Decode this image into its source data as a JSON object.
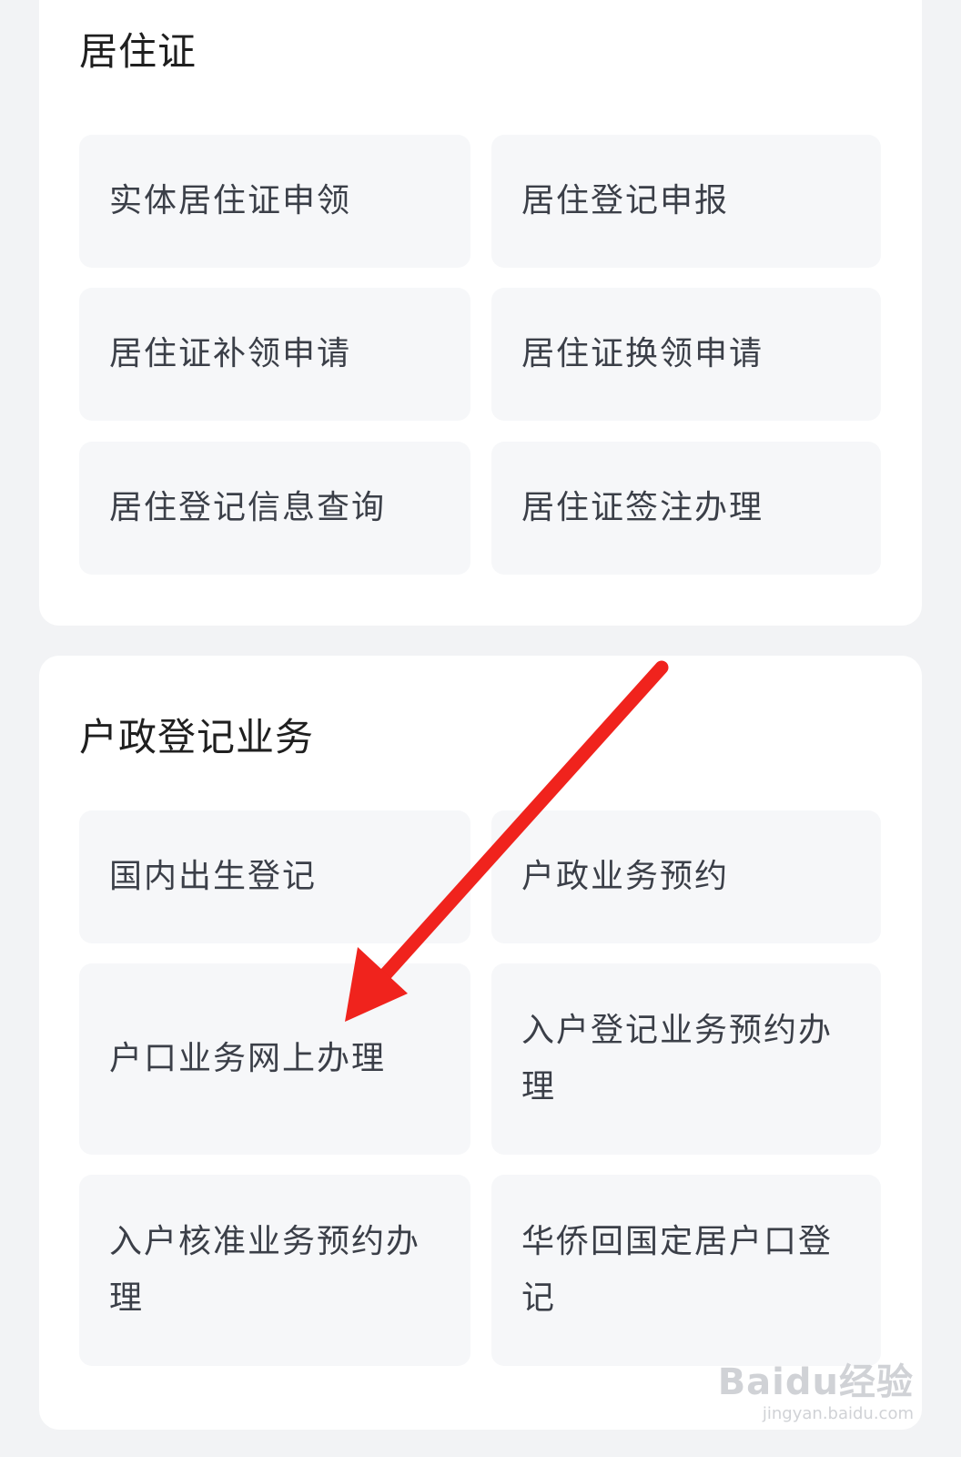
{
  "sections": [
    {
      "title": "居住证",
      "items": [
        "实体居住证申领",
        "居住登记申报",
        "居住证补领申请",
        "居住证换领申请",
        "居住登记信息查询",
        "居住证签注办理"
      ]
    },
    {
      "title": "户政登记业务",
      "items": [
        "国内出生登记",
        "户政业务预约",
        "户口业务网上办理",
        "入户登记业务预约办理",
        "入户核准业务预约办理",
        "华侨回国定居户口登记"
      ]
    }
  ],
  "annotation": {
    "arrow_color": "#f0231d"
  },
  "watermark": {
    "logo": "Baidu经验",
    "url": "jingyan.baidu.com"
  }
}
